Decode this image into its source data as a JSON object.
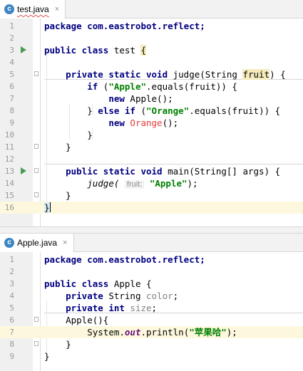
{
  "editors": [
    {
      "tab": {
        "icon": "class-icon",
        "icon_letter": "c",
        "label": "test.java",
        "close": "×"
      },
      "lines": [
        "1",
        "2",
        "3",
        "4",
        "5",
        "6",
        "7",
        "8",
        "9",
        "10",
        "11",
        "12",
        "13",
        "14",
        "15",
        "16"
      ],
      "code": {
        "l1": "package com.eastrobot.reflect;",
        "l3_kw": "public class ",
        "l3_name": "test ",
        "l3_brace": "{",
        "l5_kw": "private static void ",
        "l5_a": "judge(String ",
        "l5_param": "fruit",
        "l5_b": ") {",
        "l6_kw": "if ",
        "l6_a": "(",
        "l6_str": "\"Apple\"",
        "l6_b": ".equals(fruit)) {",
        "l7_kw": "new ",
        "l7_a": "Apple();",
        "l8_a": "} ",
        "l8_kw": "else if ",
        "l8_b": "(",
        "l8_str": "\"Orange\"",
        "l8_c": ".equals(fruit)) {",
        "l9_kw": "new ",
        "l9_err": "Orange",
        "l9_a": "();",
        "l10": "}",
        "l11": "}",
        "l13_kw": "public static void ",
        "l13_a": "main(String[] args) {",
        "l14_call": "judge(",
        "l14_hint": "fruit:",
        "l14_str": "\"Apple\"",
        "l14_a": ");",
        "l15": "}",
        "l16": "}"
      }
    },
    {
      "tab": {
        "icon": "class-icon",
        "icon_letter": "c",
        "label": "Apple.java",
        "close": "×"
      },
      "lines": [
        "1",
        "2",
        "3",
        "4",
        "5",
        "6",
        "7",
        "8",
        "9"
      ],
      "code": {
        "l1": "package com.eastrobot.reflect;",
        "l3_kw": "public class ",
        "l3_a": "Apple {",
        "l4_kw": "private ",
        "l4_a": "String ",
        "l4_field": "color",
        "l4_end": ";",
        "l5_kw": "private int ",
        "l5_field": "size",
        "l5_end": ";",
        "l6": "Apple(){",
        "l7_a": "System.",
        "l7_out": "out",
        "l7_b": ".println(",
        "l7_str": "\"苹果哈\"",
        "l7_c": ");",
        "l8": "}",
        "l9": "}"
      }
    }
  ]
}
